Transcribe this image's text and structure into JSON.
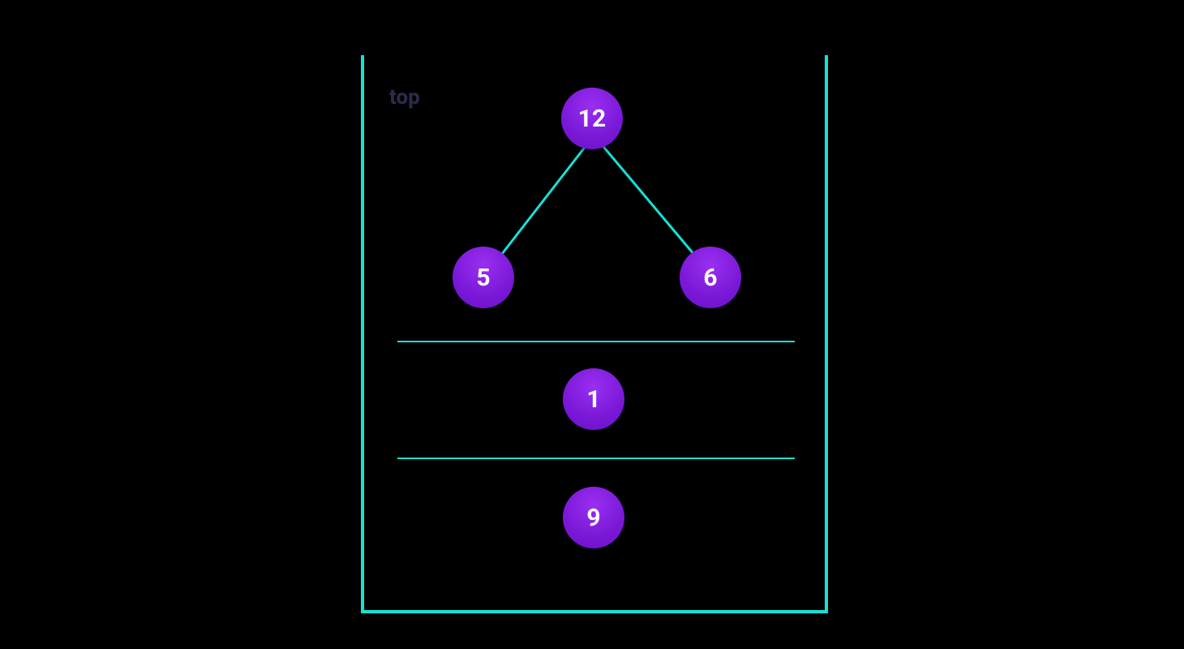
{
  "labels": {
    "top": "top"
  },
  "nodes": {
    "root": "12",
    "left": "5",
    "right": "6",
    "mid": "1",
    "bottom": "9"
  },
  "colors": {
    "stroke": "#18e0d6",
    "node_gradient_top": "#9a2ff0",
    "node_gradient_bottom": "#6a10c8",
    "label": "#2a2a4a",
    "bg": "#000000"
  }
}
